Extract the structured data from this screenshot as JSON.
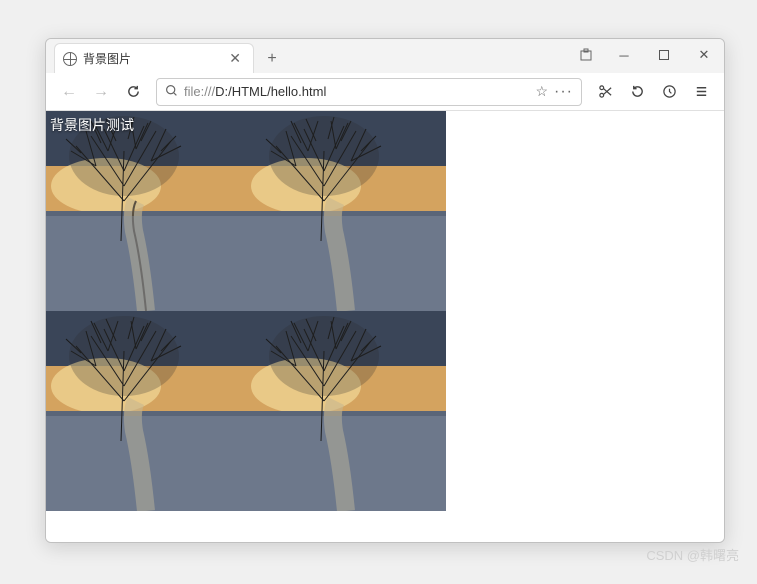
{
  "window": {
    "minimize": "─",
    "maximize": "□",
    "close": "✕",
    "extension": "⬚"
  },
  "tab": {
    "title": "背景图片",
    "close": "✕"
  },
  "newtab": "+",
  "toolbar": {
    "back": "←",
    "forward": "→",
    "reload": "↻",
    "url_prefix": "file:///",
    "url_path": "D:/HTML/hello.html",
    "star": "☆",
    "more": "···",
    "scissors": "✂",
    "undo": "↺",
    "clock": "◷",
    "menu": "≡"
  },
  "page": {
    "overlay_text": "背景图片测试"
  },
  "watermark": "CSDN @韩曙亮"
}
